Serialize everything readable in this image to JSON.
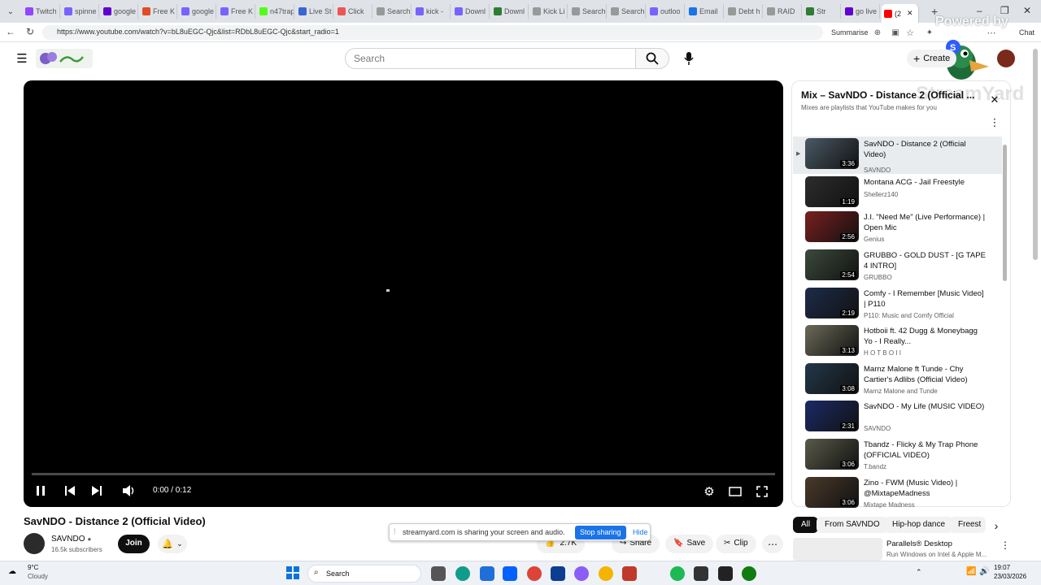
{
  "browser": {
    "tabs": [
      {
        "label": "Twitch",
        "color": "#9146ff"
      },
      {
        "label": "spinne",
        "color": "#7b61ff"
      },
      {
        "label": "google",
        "color": "#6001d2"
      },
      {
        "label": "Free K",
        "color": "#e24b26"
      },
      {
        "label": "google",
        "color": "#7b61ff"
      },
      {
        "label": "Free K",
        "color": "#7b61ff"
      },
      {
        "label": "n47trap",
        "color": "#53fc18"
      },
      {
        "label": "Live St",
        "color": "#3a66d4"
      },
      {
        "label": "Click",
        "color": "#e55"
      },
      {
        "label": "Search",
        "color": "#999"
      },
      {
        "label": "kick -",
        "color": "#7b61ff"
      },
      {
        "label": "Downl",
        "color": "#7b61ff"
      },
      {
        "label": "Downl",
        "color": "#2e7d32"
      },
      {
        "label": "Kick Li",
        "color": "#999"
      },
      {
        "label": "Search",
        "color": "#999"
      },
      {
        "label": "Search",
        "color": "#999"
      },
      {
        "label": "outloo",
        "color": "#7b61ff"
      },
      {
        "label": "Email",
        "color": "#1a73e8"
      },
      {
        "label": "Debt h",
        "color": "#999"
      },
      {
        "label": "RAID",
        "color": "#999"
      },
      {
        "label": "Str",
        "color": "#2e7d32"
      },
      {
        "label": "go live",
        "color": "#6001d2"
      },
      {
        "label": "(2",
        "color": "#ff0000"
      }
    ],
    "new_tab": "+",
    "url": "https://www.youtube.com/watch?v=bL8uEGC-Qjc&list=RDbL8uEGC-Qjc&start_radio=1",
    "summarise": "Summarise",
    "chat": "Chat"
  },
  "overlay": {
    "powered_by": "Powered by",
    "streamyard": "StreamYard"
  },
  "youtube": {
    "search_placeholder": "Search",
    "create_label": "Create",
    "player": {
      "time": "0:00 / 0:12",
      "progress": 0
    },
    "video_title": "SavNDO - Distance 2 (Official Video)",
    "channel": {
      "name": "SAVNDO",
      "subscribers": "16.5k subscribers",
      "join": "Join"
    },
    "actions": {
      "likes": "2.7K",
      "share": "Share",
      "save": "Save",
      "clip": "Clip"
    },
    "share_banner": {
      "text": "streamyard.com is sharing your screen and audio.",
      "stop": "Stop sharing",
      "hide": "Hide"
    },
    "playlist": {
      "title": "Mix – SavNDO - Distance 2 (Official ...",
      "subtitle": "Mixes are playlists that YouTube makes for you",
      "items": [
        {
          "title": "SavNDO - Distance 2 (Official Video)",
          "channel": "SAVNDO",
          "duration": "3:36",
          "color": "#4a5a66"
        },
        {
          "title": "Montana ACG - Jail Freestyle",
          "channel": "Shellerz140",
          "duration": "1:19",
          "color": "#2d2d2d"
        },
        {
          "title": "J.I. \"Need Me\" (Live Performance) | Open Mic",
          "channel": "Genius",
          "duration": "2:56",
          "color": "#7a1f1f"
        },
        {
          "title": "GRUBBO - GOLD DUST - [G TAPE 4 INTRO]",
          "channel": "GRUBBO",
          "duration": "2:54",
          "color": "#3b4a3b"
        },
        {
          "title": "Comfy - I Remember [Music Video] | P110",
          "channel": "P110: Music and Comfy Official",
          "duration": "2:19",
          "color": "#1d2c4a"
        },
        {
          "title": "Hotboii ft. 42 Dugg & Moneybagg Yo - I Really...",
          "channel": "H O T B O I I",
          "duration": "3:13",
          "color": "#6c6a58"
        },
        {
          "title": "Marnz Malone ft Tunde - Chy Cartier's Adlibs (Official Video)",
          "channel": "Marnz Malone and Tunde",
          "duration": "3:08",
          "color": "#22384a"
        },
        {
          "title": "SavNDO - My Life (MUSIC VIDEO)",
          "channel": "SAVNDO",
          "duration": "2:31",
          "color": "#1b2a66"
        },
        {
          "title": "Tbandz - Flicky & My Trap Phone (OFFICIAL VIDEO)",
          "channel": "T.bandz",
          "duration": "3:06",
          "color": "#5a5a4a"
        },
        {
          "title": "Zino - FWM (Music Video) | @MixtapeMadness",
          "channel": "Mixtape Madness",
          "duration": "3:06",
          "color": "#4a3a2a"
        }
      ]
    },
    "chips": [
      "All",
      "From SAVNDO",
      "Hip-hop dance",
      "Freest"
    ],
    "ad": {
      "title": "Parallels® Desktop",
      "subtitle": "Run Windows on Intel & Apple M..."
    }
  },
  "taskbar": {
    "weather_temp": "9°C",
    "weather_desc": "Cloudy",
    "search": "Search",
    "time": "19:07",
    "date": "23/03/2026"
  }
}
